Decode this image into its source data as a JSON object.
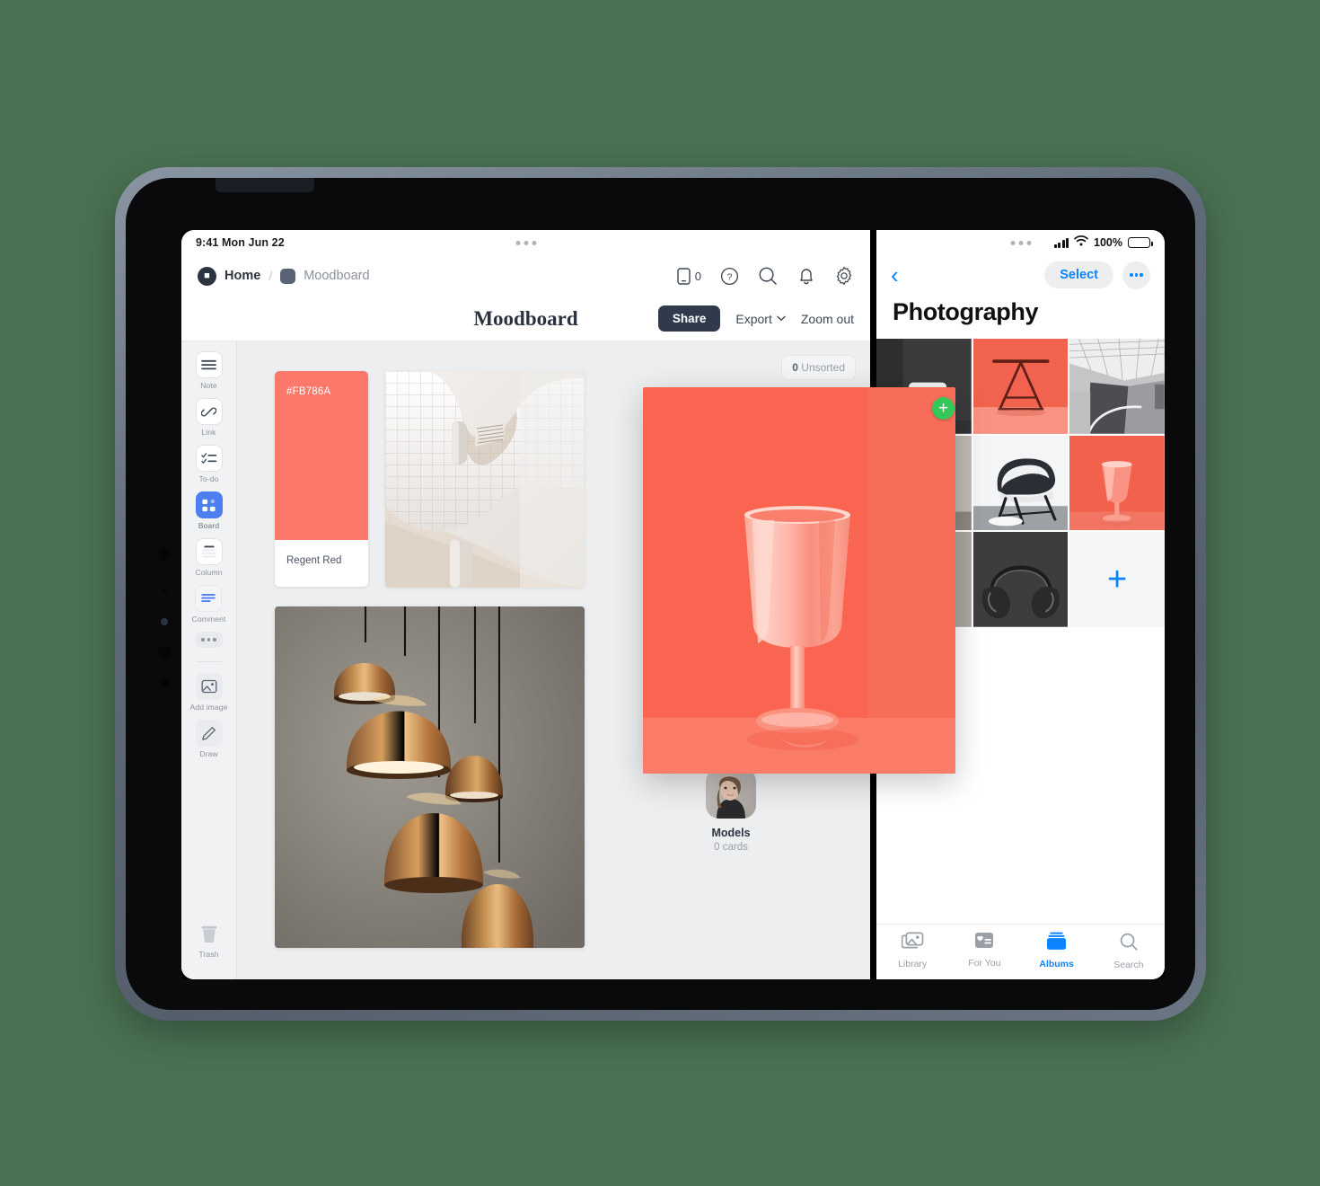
{
  "background_color": "#4a7152",
  "left_app": {
    "statusbar": {
      "time_date": "9:41  Mon Jun 22"
    },
    "breadcrumb": {
      "home_label": "Home",
      "separator": "/",
      "board_label": "Moodboard"
    },
    "topbar_icons": [
      {
        "name": "device-icon",
        "count": "0"
      },
      {
        "name": "help-icon"
      },
      {
        "name": "search-icon"
      },
      {
        "name": "notifications-icon"
      },
      {
        "name": "settings-icon"
      }
    ],
    "title": "Moodboard",
    "actions": {
      "share_label": "Share",
      "export_label": "Export",
      "zoom_out_label": "Zoom out"
    },
    "sidebar": {
      "tools": [
        {
          "label": "Note",
          "icon": "note-icon"
        },
        {
          "label": "Link",
          "icon": "link-icon"
        },
        {
          "label": "To-do",
          "icon": "todo-icon"
        },
        {
          "label": "Board",
          "icon": "board-icon",
          "active": true
        },
        {
          "label": "Column",
          "icon": "column-icon"
        },
        {
          "label": "Comment",
          "icon": "comment-icon"
        },
        {
          "label": "",
          "icon": "more-icon"
        },
        {
          "label": "Add image",
          "icon": "add-image-icon"
        },
        {
          "label": "Draw",
          "icon": "draw-icon"
        }
      ],
      "trash_label": "Trash"
    },
    "canvas": {
      "unsorted_count": "0",
      "unsorted_label": "Unsorted",
      "color_card": {
        "hex": "#FB786A",
        "name": "Regent Red",
        "swatch_color": "#FB786A"
      },
      "cards": [
        {
          "name": "architecture-photo-card"
        },
        {
          "name": "pendant-lamps-photo-card"
        }
      ],
      "folder": {
        "name": "Models",
        "count": "0 cards"
      },
      "drag_item": {
        "name": "coral-wine-glass-photo",
        "badge": "+",
        "badge_color": "#35c759"
      }
    }
  },
  "right_app": {
    "statusbar": {
      "battery_percent": "100%",
      "signal": "cellular-signal-icon",
      "wifi": "wifi-icon"
    },
    "navbar": {
      "back_icon": "chevron-left-icon",
      "select_label": "Select",
      "more_icon": "ellipsis-icon"
    },
    "title": "Photography",
    "grid": [
      {
        "name": "photo-sofa-dark"
      },
      {
        "name": "photo-coral-table"
      },
      {
        "name": "photo-architecture-corridor"
      },
      {
        "name": "photo-concrete-wall"
      },
      {
        "name": "photo-eames-chair"
      },
      {
        "name": "photo-coral-wine-glass"
      },
      {
        "name": "photo-red-lamp"
      },
      {
        "name": "photo-headphones"
      },
      {
        "name": "add-photo-cell",
        "label": "+"
      }
    ],
    "tabs": [
      {
        "label": "Library",
        "icon": "photos-library-icon",
        "active": false
      },
      {
        "label": "For You",
        "icon": "for-you-icon",
        "active": false
      },
      {
        "label": "Albums",
        "icon": "albums-icon",
        "active": true
      },
      {
        "label": "Search",
        "icon": "search-icon",
        "active": false
      }
    ]
  }
}
